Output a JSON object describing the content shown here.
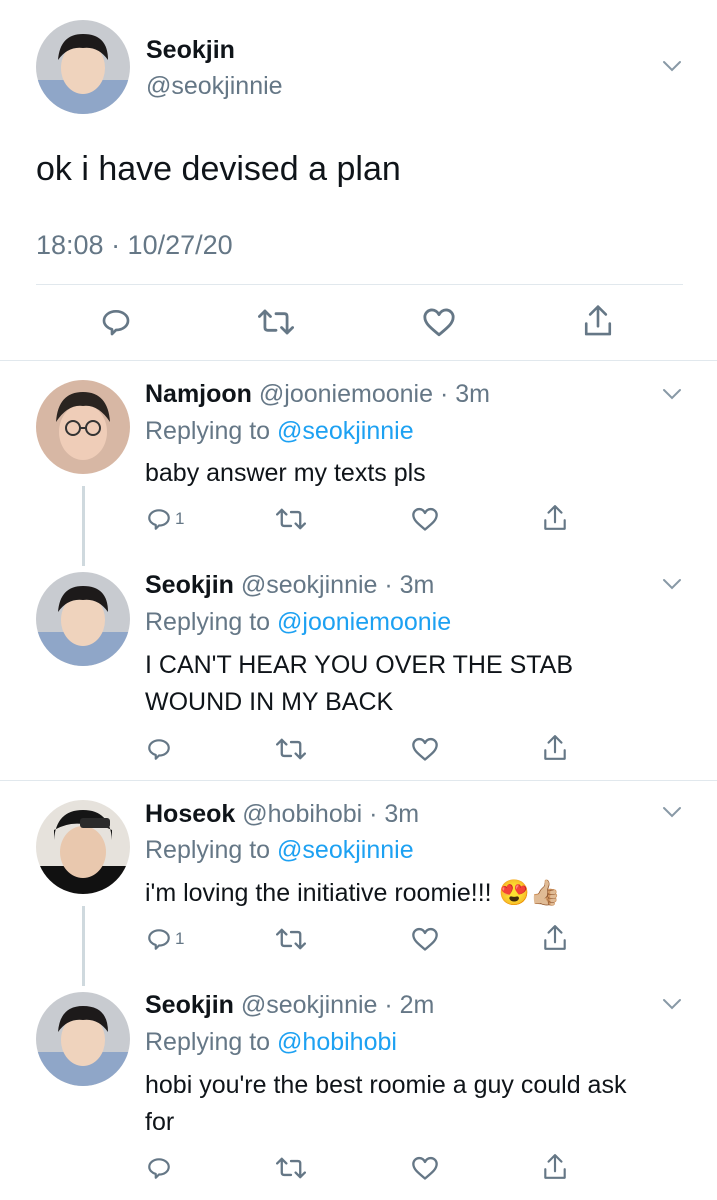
{
  "main_tweet": {
    "display_name": "Seokjin",
    "handle": "@seokjinnie",
    "text": "ok i have devised a plan",
    "timestamp": "18:08 · 10/27/20"
  },
  "replies": [
    {
      "display_name": "Namjoon",
      "handle": "@jooniemoonie",
      "time_ago": "3m",
      "replying_label": "Replying to",
      "replying_to": "@seokjinnie",
      "text": "baby answer my texts pls",
      "reply_count": "1"
    },
    {
      "display_name": "Seokjin",
      "handle": "@seokjinnie",
      "time_ago": "3m",
      "replying_label": "Replying to",
      "replying_to": "@jooniemoonie",
      "text": "I CAN'T HEAR YOU OVER THE STAB WOUND IN MY BACK",
      "reply_count": ""
    },
    {
      "display_name": "Hoseok",
      "handle": "@hobihobi",
      "time_ago": "3m",
      "replying_label": "Replying to",
      "replying_to": "@seokjinnie",
      "text": "i'm loving the initiative roomie!!! 😍👍🏼",
      "reply_count": "1"
    },
    {
      "display_name": "Seokjin",
      "handle": "@seokjinnie",
      "time_ago": "2m",
      "replying_label": "Replying to",
      "replying_to": "@hobihobi",
      "text": "hobi you're the best roomie a guy could ask for",
      "reply_count": ""
    }
  ],
  "icons": {
    "reply": "reply-icon",
    "retweet": "retweet-icon",
    "like": "heart-icon",
    "share": "share-icon",
    "more": "chevron-down-icon"
  },
  "colors": {
    "link": "#1da1f2",
    "muted": "#657786",
    "divider": "#e1e8ed",
    "thread_line": "#cfd9de"
  }
}
